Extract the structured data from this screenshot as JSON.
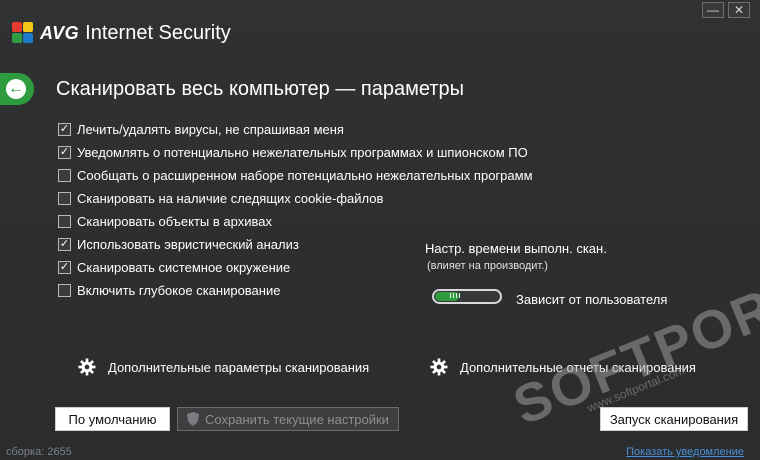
{
  "app": {
    "brand": "AVG",
    "product": "Internet Security",
    "minimize_symbol": "—",
    "close_symbol": "✕"
  },
  "header": {
    "back_symbol": "←",
    "title": "Сканировать весь компьютер — параметры"
  },
  "options": [
    {
      "label": "Лечить/удалять вирусы, не спрашивая меня",
      "checked": true
    },
    {
      "label": "Уведомлять о потенциально нежелательных программах и шпионском ПО",
      "checked": true
    },
    {
      "label": "Сообщать о расширенном наборе потенциально нежелательных программ",
      "checked": false
    },
    {
      "label": "Сканировать на наличие следящих cookie-файлов",
      "checked": false
    },
    {
      "label": "Сканировать объекты в архивах",
      "checked": false
    },
    {
      "label": "Использовать эвристический анализ",
      "checked": true
    },
    {
      "label": "Сканировать системное окружение",
      "checked": true
    },
    {
      "label": "Включить глубокое сканирование",
      "checked": false
    }
  ],
  "schedule": {
    "title": "Настр. времени выполн. скан.",
    "subtitle": "(влияет на производит.)",
    "slider_label": "Зависит от пользователя",
    "slider_level": 0.25
  },
  "links": {
    "advanced_params": "Дополнительные параметры сканирования",
    "advanced_reports": "Дополнительные отчеты сканирования"
  },
  "buttons": {
    "default": "По умолчанию",
    "save": "Сохранить текущие настройки",
    "start": "Запуск сканирования"
  },
  "footer": {
    "build": "сборка: 2655",
    "notify": "Показать уведомление"
  },
  "watermark": {
    "big": "SOFTPORTAL",
    "small": "www.softportal.com"
  },
  "colors": {
    "accent_green": "#2e9b3f",
    "background": "#2b2d2f",
    "link_blue": "#4b8fd6"
  }
}
